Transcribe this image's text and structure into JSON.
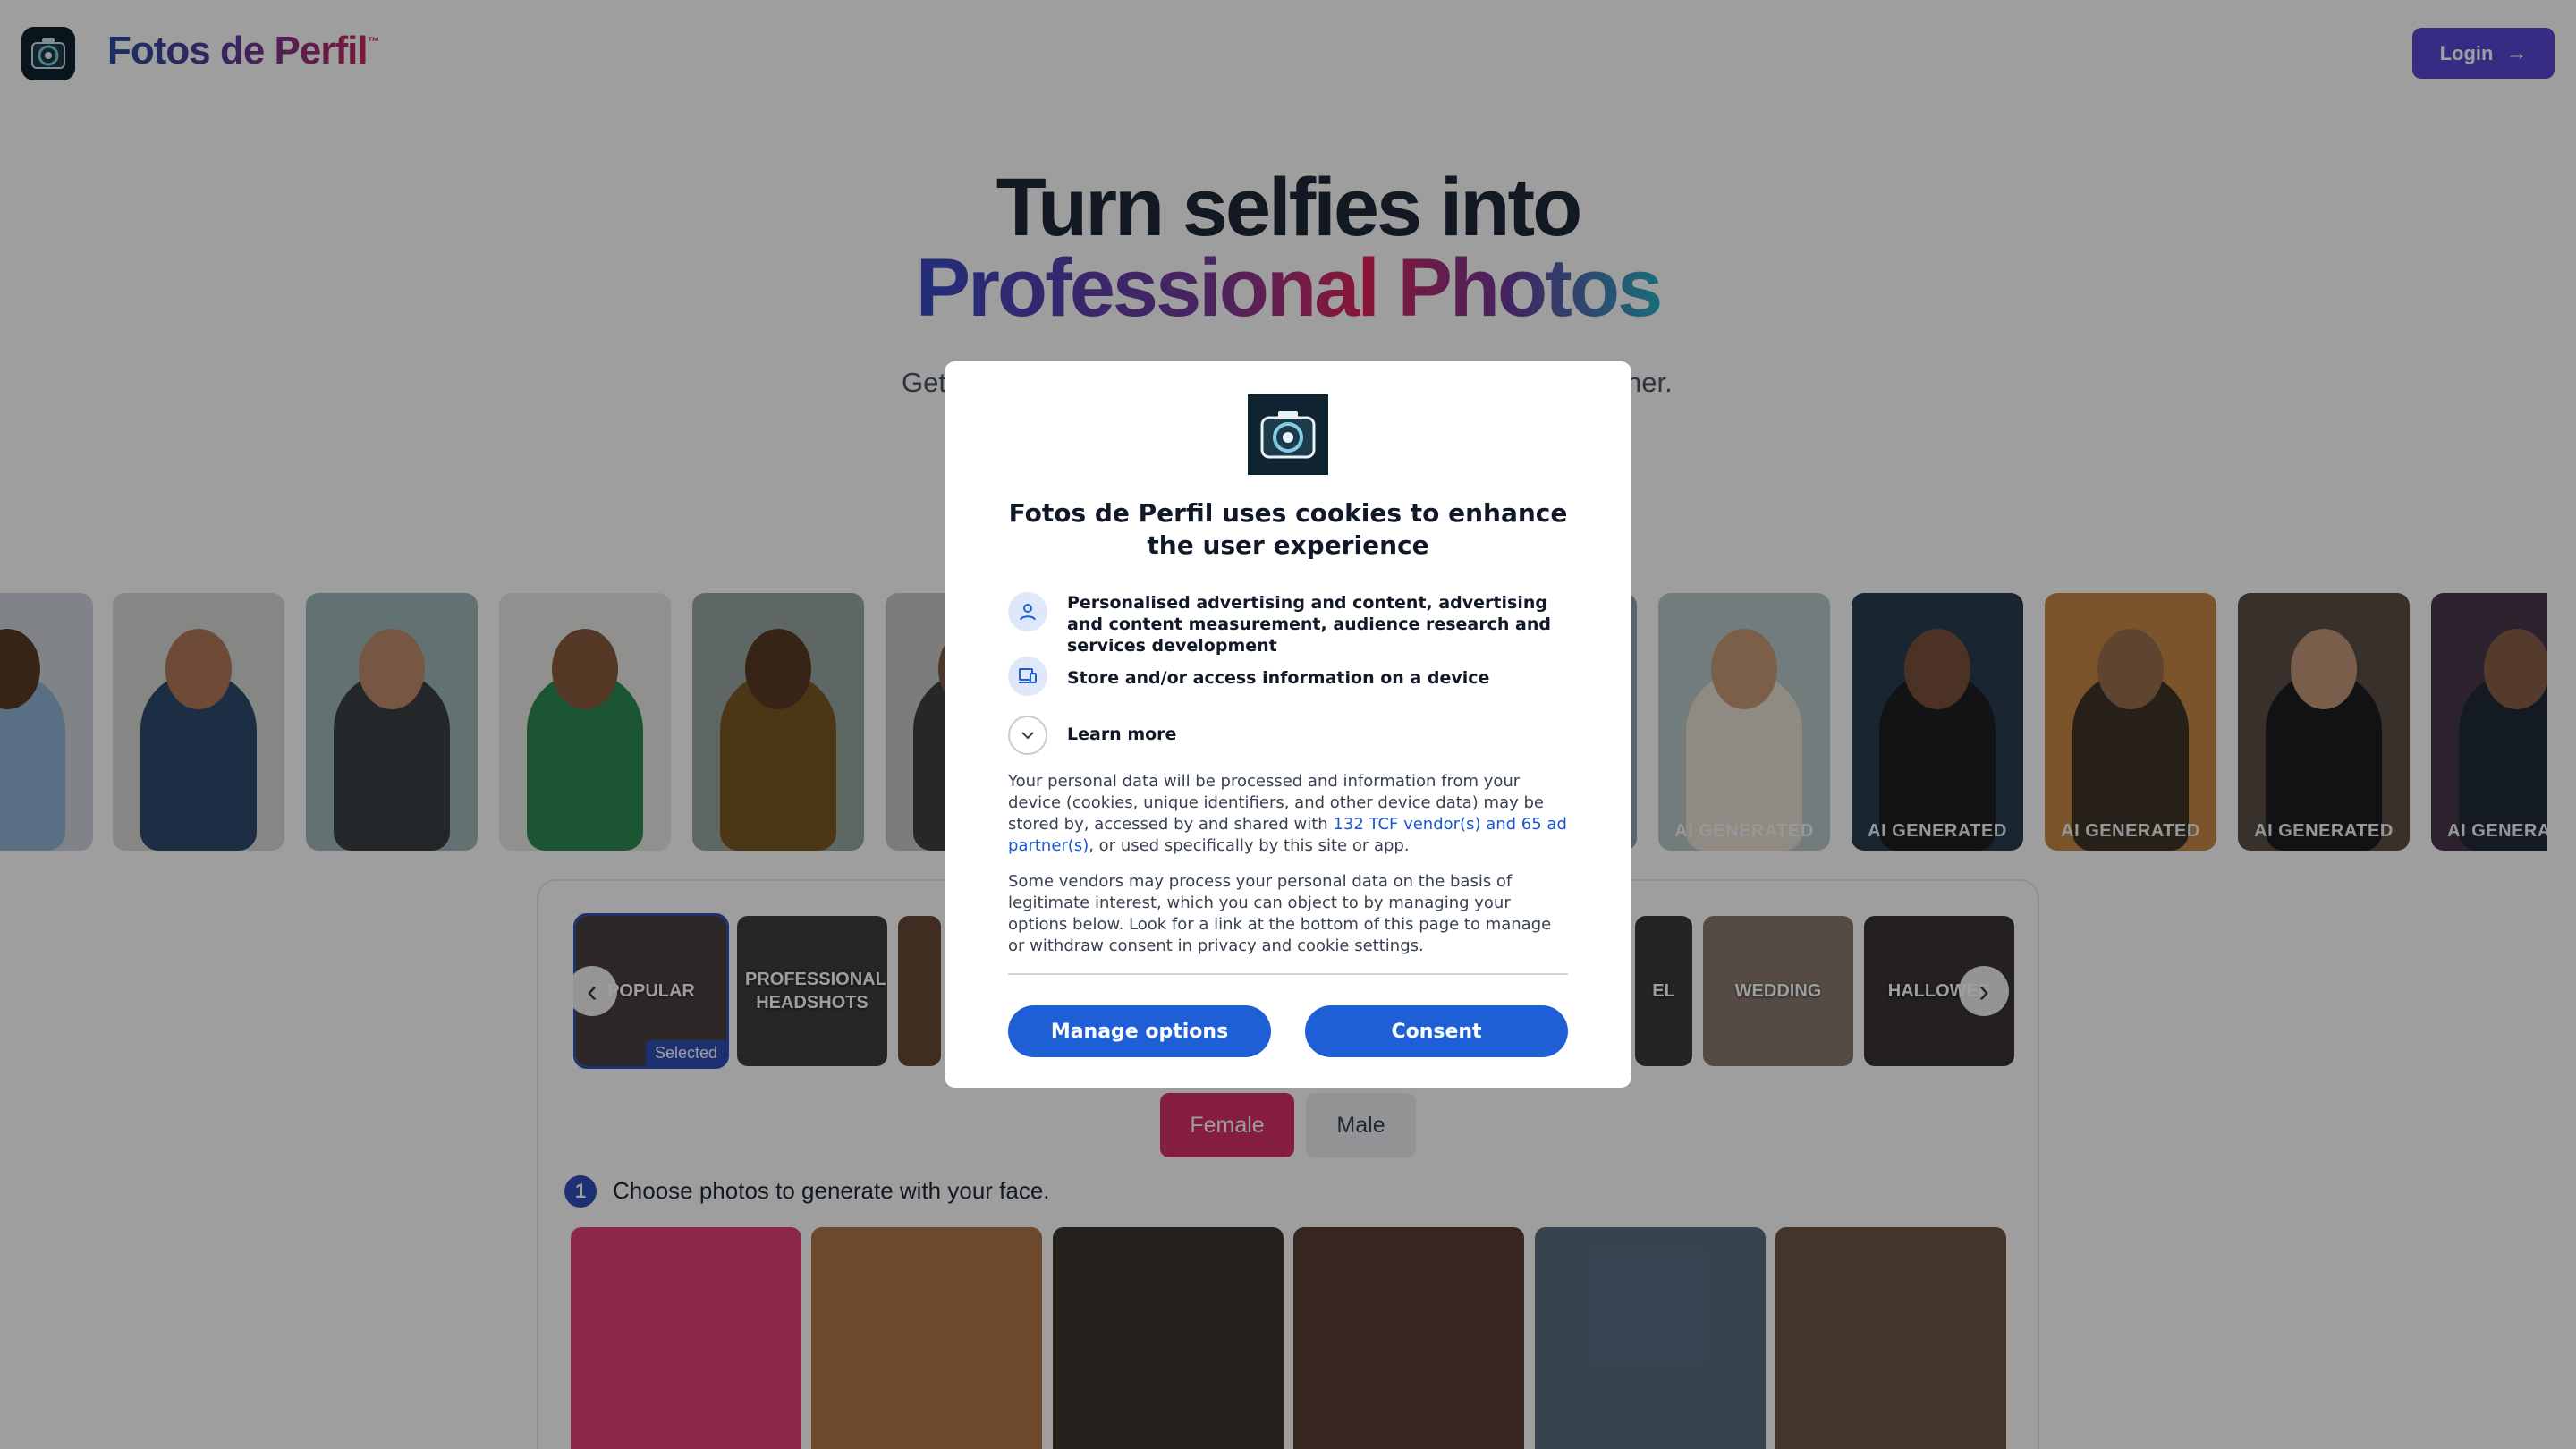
{
  "header": {
    "brand": "Fotos de Perfil",
    "brand_tm": "™",
    "login_label": "Login",
    "login_icon": "arrow-right-icon"
  },
  "hero": {
    "line1": "Turn selfies into",
    "line2": "Professional Photos",
    "subtitle_left": "Get",
    "subtitle_right": "her."
  },
  "strip": {
    "ai_badge": "AI GENERATED"
  },
  "categories": {
    "items": [
      {
        "label": "POPULAR",
        "selected": true
      },
      {
        "label": "PROFESSIONAL HEADSHOTS",
        "selected": false
      },
      {
        "label": "EL",
        "selected": false
      },
      {
        "label": "WEDDING",
        "selected": false
      },
      {
        "label": "HALLOWEE",
        "selected": false
      }
    ],
    "selected_badge": "Selected",
    "prev_icon": "chevron-left-icon",
    "next_icon": "chevron-right-icon"
  },
  "gender": {
    "female": "Female",
    "male": "Male",
    "active": "Female"
  },
  "step1": {
    "number": "1",
    "text": "Choose photos to generate with your face."
  },
  "consent": {
    "title": "Fotos de Perfil uses cookies to enhance the user experience",
    "purposes": [
      {
        "icon": "person-icon",
        "text": "Personalised advertising and content, advertising and content measurement, audience research and services development"
      },
      {
        "icon": "device-icon",
        "text": "Store and/or access information on a device"
      }
    ],
    "learn_more": "Learn more",
    "para1_before": "Your personal data will be processed and information from your device (cookies, unique identifiers, and other device data) may be stored by, accessed by and shared with ",
    "para1_link": "132 TCF vendor(s) and 65 ad partner(s)",
    "para1_after": ", or used specifically by this site or app.",
    "para2": "Some vendors may process your personal data on the basis of legitimate interest, which you can object to by managing your options below. Look for a link at the bottom of this page to manage or withdraw consent in privacy and cookie settings.",
    "manage_label": "Manage options",
    "consent_label": "Consent"
  },
  "colors": {
    "accent_blue": "#1f5fd6",
    "brand_pink": "#d5306a",
    "login_purple": "#5848d6"
  }
}
